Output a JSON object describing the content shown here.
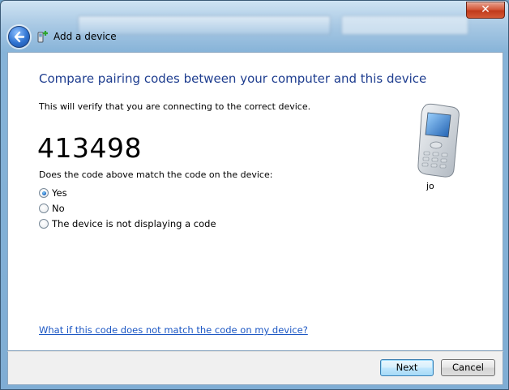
{
  "window": {
    "title": "Add a device",
    "close_label": "✕"
  },
  "page": {
    "heading": "Compare pairing codes between your computer and this device",
    "verify_text": "This will verify that you are connecting to the correct device.",
    "code": "413498",
    "question": "Does the code above match the code on the device:",
    "options": [
      {
        "label": "Yes",
        "checked": true
      },
      {
        "label": "No",
        "checked": false
      },
      {
        "label": "The device is not displaying a code",
        "checked": false
      }
    ],
    "device_name": "jo",
    "help_link": "What if this code does not match the code on my device?"
  },
  "buttons": {
    "next": "Next",
    "cancel": "Cancel"
  },
  "colors": {
    "heading": "#1e3d8f",
    "link": "#1c57c4",
    "accent": "#2f73d1"
  }
}
